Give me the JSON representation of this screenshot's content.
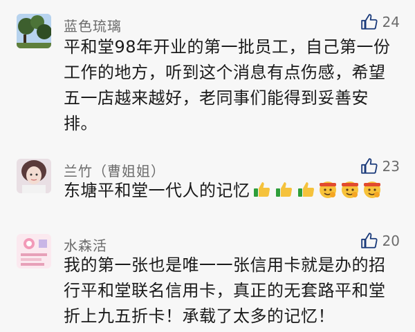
{
  "comments": [
    {
      "author": "蓝色琉璃",
      "likes": "24",
      "text": "平和堂98年开业的第一批员工，自己第一份工作的地方，听到这个消息有点伤感，希望五一店越来越好，老同事们能得到妥善安排。",
      "lines": [
        "平和堂98年开业的第一批员工，自己第一份",
        "工作的地方，听到这个消息有点伤感，希望",
        "五一店越来越好，老同事们能得到妥善安",
        "排。"
      ],
      "avatar_icon": "tree-photo-avatar"
    },
    {
      "author": "兰竹（曹姐姐）",
      "likes": "23",
      "text": "东塘平和堂一代人的记忆",
      "lines": [
        "东塘平和堂一代人的记忆"
      ],
      "emojis": [
        "thumbs-up",
        "thumbs-up",
        "thumbs-up",
        "salute-face",
        "salute-face",
        "salute-face"
      ],
      "avatar_icon": "person-photo-avatar"
    },
    {
      "author": "水森活",
      "likes": "20",
      "text": "我的第一张也是唯一一张信用卡就是办的招行平和堂联名信用卡，真正的无套路平和堂折上九五折卡！承载了太多的记忆！",
      "lines": [
        "我的第一张也是唯一一张信用卡就是办的招",
        "行平和堂联名信用卡，真正的无套路平和堂",
        "折上九五折卡！承载了太多的记忆！"
      ],
      "avatar_icon": "card-image-avatar"
    }
  ],
  "colors": {
    "background": "#f7f7f7",
    "author": "#6b6b6b",
    "text": "#1a1a1a",
    "like_icon": "#1a3a7a"
  }
}
